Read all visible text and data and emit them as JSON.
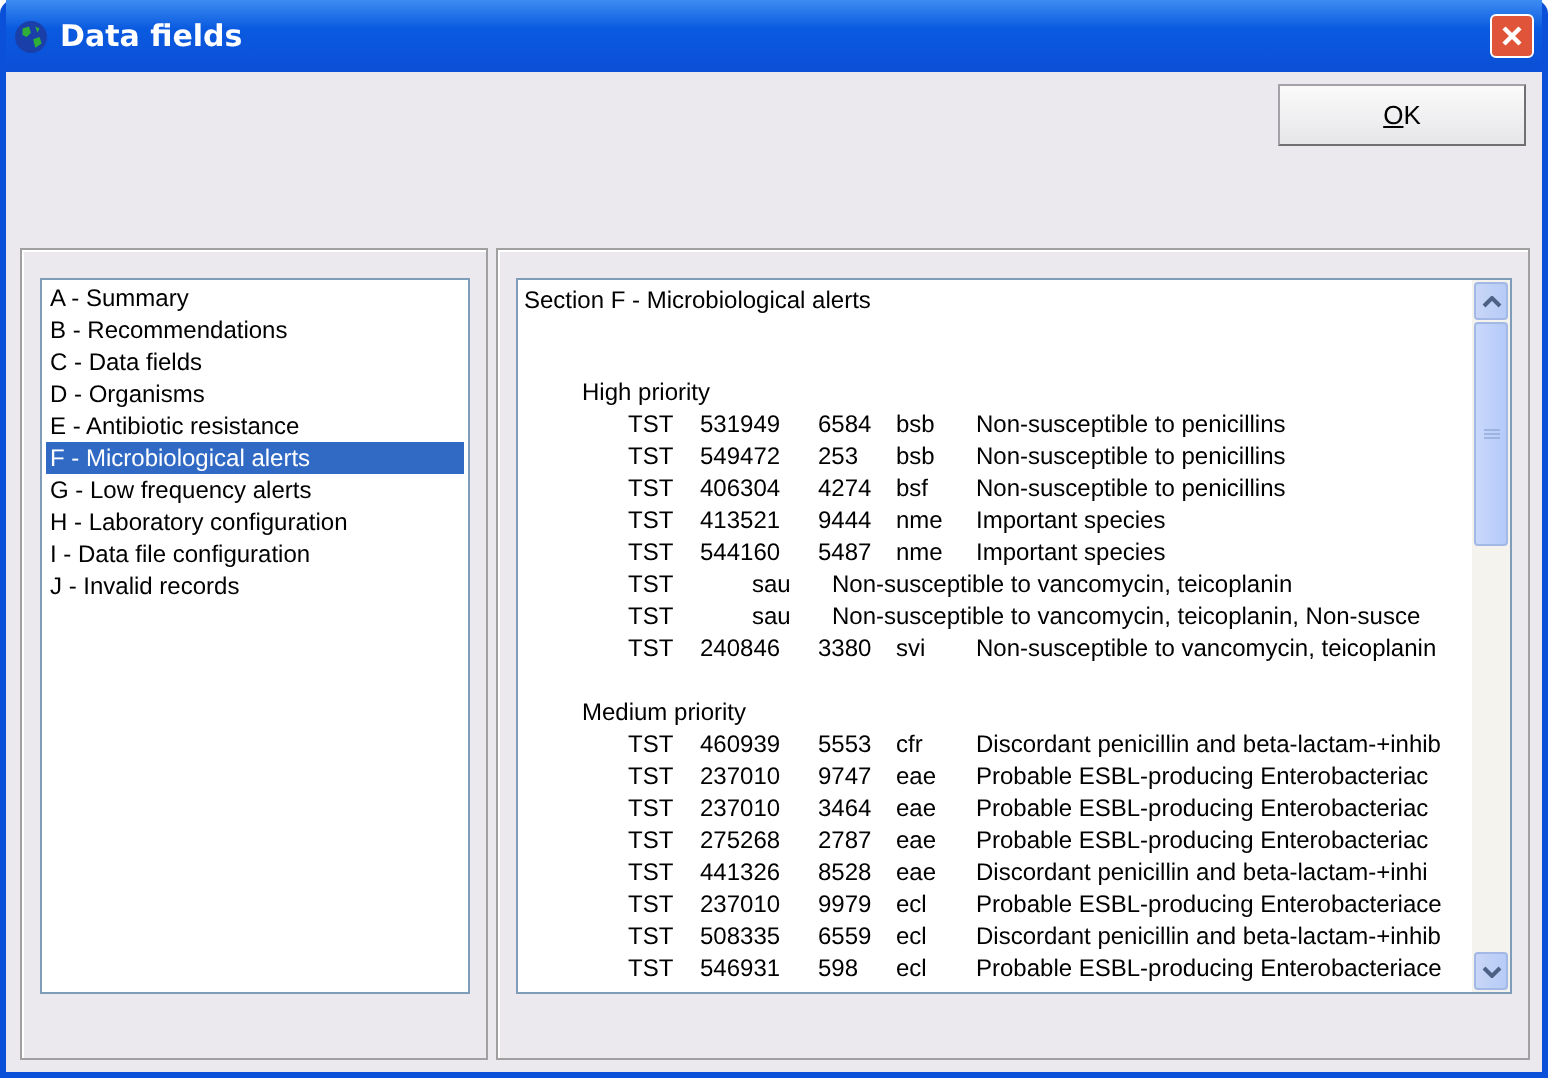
{
  "window": {
    "title": "Data fields"
  },
  "buttons": [
    {
      "label": "OK",
      "mnemonic_underline": true
    }
  ],
  "sections": [
    {
      "label": "A - Summary",
      "selected": false
    },
    {
      "label": "B - Recommendations",
      "selected": false
    },
    {
      "label": "C - Data fields",
      "selected": false
    },
    {
      "label": "D - Organisms",
      "selected": false
    },
    {
      "label": "E - Antibiotic resistance",
      "selected": false
    },
    {
      "label": "F - Microbiological alerts",
      "selected": true
    },
    {
      "label": "G - Low frequency alerts",
      "selected": false
    },
    {
      "label": "H - Laboratory configuration",
      "selected": false
    },
    {
      "label": "I - Data file configuration",
      "selected": false
    },
    {
      "label": "J - Invalid records",
      "selected": false
    }
  ],
  "report": {
    "heading": "Section F - Microbiological alerts",
    "groups": [
      {
        "title": "High priority",
        "rows": [
          {
            "lab": "TST",
            "patient": "531949",
            "specimen": "6584",
            "organism": "bsb",
            "alert": "Non-susceptible to penicillins"
          },
          {
            "lab": "TST",
            "patient": "549472",
            "specimen": "253",
            "organism": "bsb",
            "alert": "Non-susceptible to penicillins"
          },
          {
            "lab": "TST",
            "patient": "406304",
            "specimen": "4274",
            "organism": "bsf",
            "alert": "Non-susceptible to penicillins"
          },
          {
            "lab": "TST",
            "patient": "413521",
            "specimen": "9444",
            "organism": "nme",
            "alert": "Important species"
          },
          {
            "lab": "TST",
            "patient": "544160",
            "specimen": "5487",
            "organism": "nme",
            "alert": "Important species"
          },
          {
            "lab": "TST",
            "organism": "sau",
            "alert": "Non-susceptible to vancomycin, teicoplanin"
          },
          {
            "lab": "TST",
            "organism": "sau",
            "alert": "Non-susceptible to vancomycin, teicoplanin, Non-susce"
          },
          {
            "lab": "TST",
            "patient": "240846",
            "specimen": "3380",
            "organism": "svi",
            "alert": "Non-susceptible to vancomycin, teicoplanin"
          }
        ]
      },
      {
        "title": "Medium priority",
        "rows": [
          {
            "lab": "TST",
            "patient": "460939",
            "specimen": "5553",
            "organism": "cfr",
            "alert": "Discordant penicillin and beta-lactam-+inhib"
          },
          {
            "lab": "TST",
            "patient": "237010",
            "specimen": "9747",
            "organism": "eae",
            "alert": "Probable ESBL-producing Enterobacteriac"
          },
          {
            "lab": "TST",
            "patient": "237010",
            "specimen": "3464",
            "organism": "eae",
            "alert": "Probable ESBL-producing Enterobacteriac"
          },
          {
            "lab": "TST",
            "patient": "275268",
            "specimen": "2787",
            "organism": "eae",
            "alert": "Probable ESBL-producing Enterobacteriac"
          },
          {
            "lab": "TST",
            "patient": "441326",
            "specimen": "8528",
            "organism": "eae",
            "alert": "Discordant penicillin and beta-lactam-+inhi"
          },
          {
            "lab": "TST",
            "patient": "237010",
            "specimen": "9979",
            "organism": "ecl",
            "alert": "Probable ESBL-producing Enterobacteriace"
          },
          {
            "lab": "TST",
            "patient": "508335",
            "specimen": "6559",
            "organism": "ecl",
            "alert": "Discordant penicillin and beta-lactam-+inhib"
          },
          {
            "lab": "TST",
            "patient": "546931",
            "specimen": "598",
            "organism": "ecl",
            "alert": "Probable ESBL-producing Enterobacteriace"
          }
        ]
      }
    ]
  }
}
